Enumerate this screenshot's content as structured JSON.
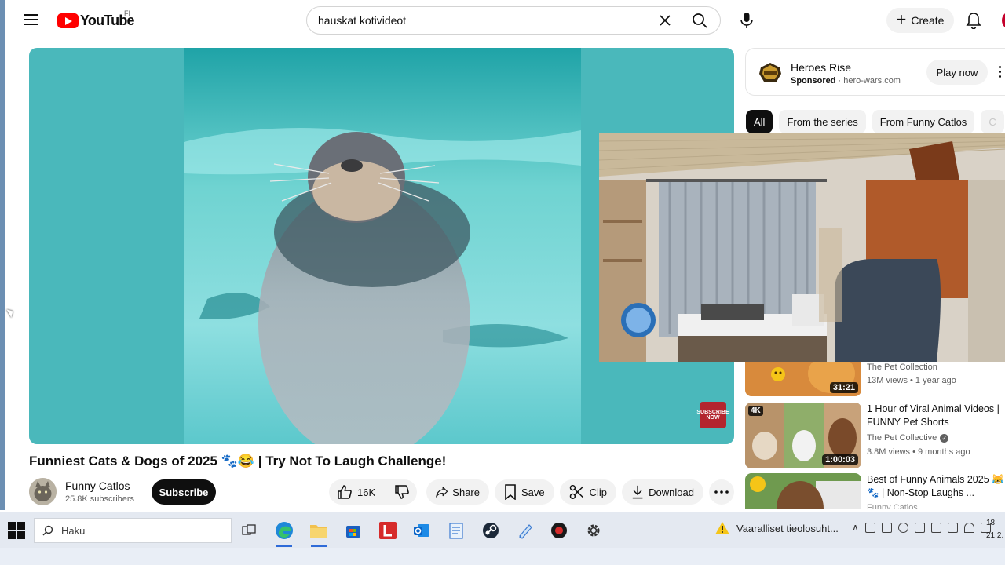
{
  "header": {
    "logo_text": "YouTube",
    "country_code": "FI",
    "search_value": "hauskat kotivideot",
    "create_label": "Create"
  },
  "video": {
    "title": "Funniest Cats & Dogs of 2025 🐾😂 | Try Not To Laugh Challenge!",
    "channel_name": "Funny Catlos",
    "channel_subscribers": "25.8K subscribers",
    "subscribe_label": "Subscribe",
    "like_count": "16K",
    "share_label": "Share",
    "save_label": "Save",
    "clip_label": "Clip",
    "download_label": "Download",
    "watermark_text": "SUBSCRIBE NOW"
  },
  "ad": {
    "title": "Heroes Rise",
    "sponsored": "Sponsored",
    "separator": " · ",
    "domain": "hero-wars.com",
    "cta": "Play now"
  },
  "chips": [
    {
      "label": "All",
      "active": true
    },
    {
      "label": "From the series"
    },
    {
      "label": "From Funny Catlos"
    },
    {
      "label": "C"
    }
  ],
  "recommendations": [
    {
      "title": "",
      "channel": "The Pet Collection",
      "meta": "13M views • 1 year ago",
      "duration": "31:21"
    },
    {
      "title": "1 Hour of Viral Animal Videos | FUNNY Pet Shorts",
      "channel": "The Pet Collective",
      "verified": true,
      "meta": "3.8M views • 9 months ago",
      "duration": "1:00:03",
      "badge": "4K"
    },
    {
      "title": "Best of Funny Animals 2025 😹🐾 | Non-Stop Laughs ...",
      "channel": "Funny Catlos",
      "meta": ""
    }
  ],
  "taskbar": {
    "search_placeholder": "Haku",
    "warning_text": "Vaaralliset tieolosuht...",
    "clock_time": "18.",
    "clock_date": "21.2."
  },
  "colors": {
    "brand_red": "#ff0000",
    "accent_blue": "#2f6bd8",
    "subscribe_bg": "#0f0f0f"
  }
}
